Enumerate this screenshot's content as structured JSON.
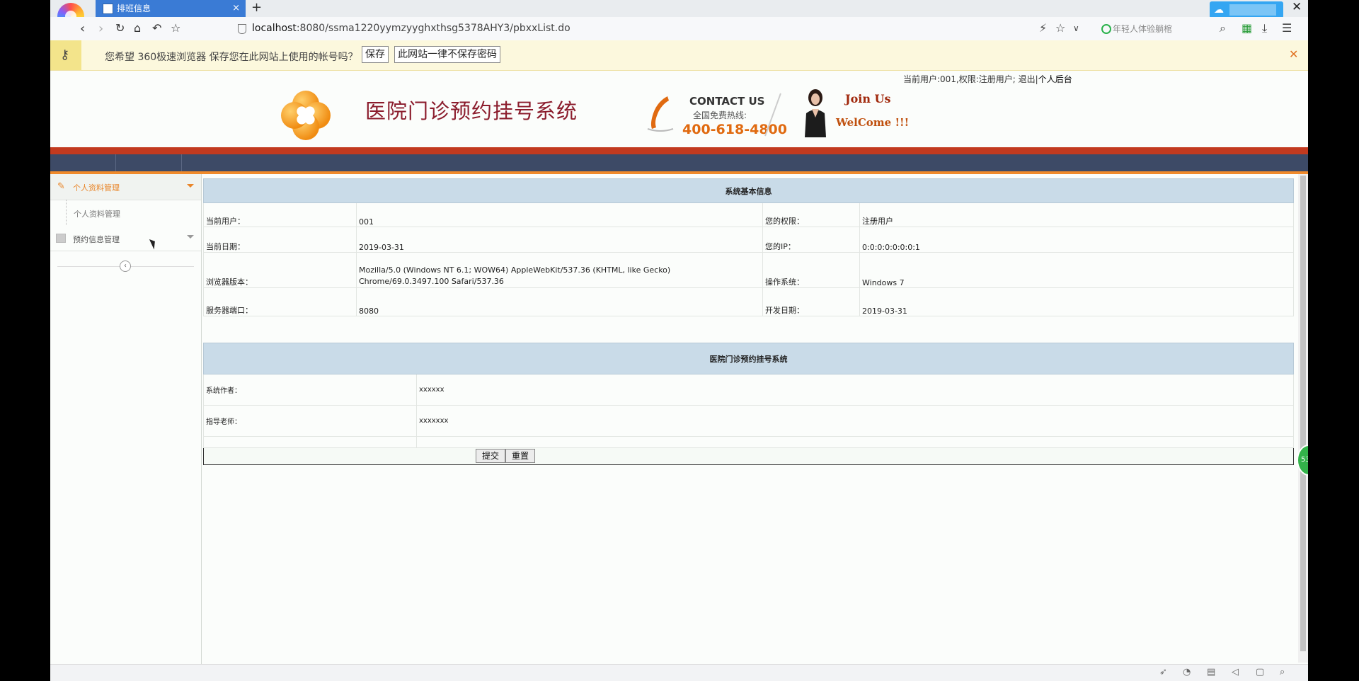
{
  "browser": {
    "tab_title": "排班信息",
    "tab_close": "×",
    "new_tab": "+",
    "window_close": "✕",
    "url_host": "localhost",
    "url_rest": ":8080/ssma1220yymzyyghxthsg5378AHY3/pbxxList.do",
    "search_placeholder": "年轻人体验躺棺",
    "icons": {
      "back": "back-icon",
      "forward": "forward-icon",
      "reload": "reload-icon",
      "home": "home-icon",
      "undo": "undo-icon",
      "favorite": "star-icon",
      "lightning": "lightning-icon",
      "search": "search-icon",
      "apps": "apps-icon",
      "download": "download-icon",
      "menu": "menu-icon"
    }
  },
  "password_bar": {
    "message": "您希望 360极速浏览器 保存您在此网站上使用的帐号吗？",
    "save_label": "保存",
    "never_label": "此网站一律不保存密码",
    "close": "✕"
  },
  "header": {
    "user_info": "当前用户:001,权限:注册用户; 退出|",
    "backend_link": "个人后台",
    "site_title": "医院门诊预约挂号系统",
    "contact_title": "CONTACT US",
    "contact_sub": "全国免费热线:",
    "contact_phone": "400-618-4800",
    "join": "Join Us",
    "welcome": "WelCome !!!"
  },
  "sidebar": {
    "menu1": "个人资料管理",
    "menu1_sub": "个人资料管理",
    "menu2": "预约信息管理",
    "collapse": "‹"
  },
  "sysinfo": {
    "title": "系统基本信息",
    "rows": [
      {
        "k1": "当前用户：",
        "v1": "001",
        "k2": "您的权限：",
        "v2": "注册用户"
      },
      {
        "k1": "当前日期：",
        "v1": "2019-03-31",
        "k2": "您的IP：",
        "v2": "0:0:0:0:0:0:0:1"
      },
      {
        "k1": "浏览器版本：",
        "v1": "Mozilla/5.0 (Windows NT 6.1; WOW64) AppleWebKit/537.36 (KHTML, like Gecko) Chrome/69.0.3497.100 Safari/537.36",
        "k2": "操作系统：",
        "v2": "Windows 7"
      },
      {
        "k1": "服务器端口：",
        "v1": "8080",
        "k2": "开发日期：",
        "v2": "2019-03-31"
      }
    ]
  },
  "about": {
    "title": "医院门诊预约挂号系统",
    "author_label": "系统作者：",
    "author_value": "xxxxxx",
    "teacher_label": "指导老师：",
    "teacher_value": "xxxxxxx",
    "submit_label": "提交",
    "reset_label": "重置"
  },
  "badge": "53",
  "colors": {
    "accent": "#e9862a",
    "header_red": "#c23a1f",
    "panel_head": "#c9dbe8",
    "title": "#8b1c2c"
  }
}
